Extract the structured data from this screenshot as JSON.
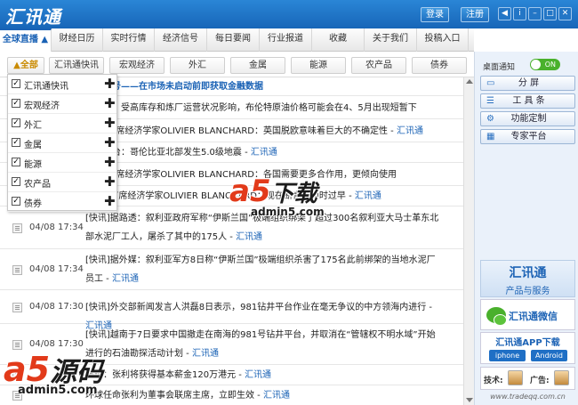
{
  "app": {
    "title": "汇讯通",
    "login_label": "登录",
    "register_label": "注册",
    "window_buttons": [
      "sound-icon",
      "info-icon",
      "minimize-icon",
      "maximize-icon",
      "close-icon"
    ]
  },
  "nav": {
    "items": [
      {
        "label": "全球直播 ▲",
        "active": true
      },
      {
        "label": "财经日历"
      },
      {
        "label": "实时行情"
      },
      {
        "label": "经济信号"
      },
      {
        "label": "每日要闻"
      },
      {
        "label": "行业报道"
      },
      {
        "label": "收藏"
      },
      {
        "label": "关于我们"
      },
      {
        "label": "投稿入口"
      }
    ]
  },
  "subnav": {
    "tabs": [
      {
        "label": "▲全部",
        "active": true
      },
      {
        "label": "汇讯通快讯"
      },
      {
        "label": "宏观经济"
      },
      {
        "label": "外汇"
      },
      {
        "label": "金属"
      },
      {
        "label": "能源"
      },
      {
        "label": "农产品"
      },
      {
        "label": "债券"
      }
    ]
  },
  "filter": {
    "items": [
      {
        "label": "汇讯通快讯",
        "checked": true
      },
      {
        "label": "宏观经济",
        "checked": true
      },
      {
        "label": "外汇",
        "checked": true
      },
      {
        "label": "金属",
        "checked": true
      },
      {
        "label": "能源",
        "checked": true
      },
      {
        "label": "农产品",
        "checked": true
      },
      {
        "label": "债券",
        "checked": true
      }
    ]
  },
  "news": {
    "source_label": "汇讯通",
    "rows": [
      {
        "time": "",
        "lines": [
          "经济信号——在市场未启动前即获取金融数据"
        ],
        "headline": true,
        "source": false
      },
      {
        "time": "",
        "lines": [
          "银美林：受高库存和炼厂运营状况影响，布伦特原油价格可能会在4、5月出现短暂下"
        ],
        "source": false
      },
      {
        "time": "",
        "lines": [
          "MF前首席经济学家OLIVIER BLANCHARD：英国脱欧意味着巨大的不确定性 - "
        ],
        "source": true
      },
      {
        "time": "",
        "lines": [
          "港天文台：哥伦比亚北部发生5.0级地震 - "
        ],
        "source": true
      },
      {
        "time": "",
        "lines": [
          "MF前首席经济学家OLIVIER BLANCHARD：各国需要更多合作用，更倾向使用"
        ],
        "source": false
      },
      {
        "time": "04/08 17:37",
        "lines": [
          "IMF前首席经济学家OLIVIER BLANCHARD：现在断言还为时过早 - "
        ],
        "source": true
      },
      {
        "time": "04/08 17:34",
        "lines": [
          "[快讯]据路透：叙利亚政府军称“伊斯兰国”极端组织绑架了超过300名叙利亚大马士革东北",
          "部水泥厂工人，屠杀了其中的175人 - "
        ],
        "source": true
      },
      {
        "time": "04/08 17:34",
        "lines": [
          "[快讯]据外媒：叙利亚军方8日称“伊斯兰国”极端组织杀害了175名此前绑架的当地水泥厂",
          "员工 - "
        ],
        "source": true
      },
      {
        "time": "04/08 17:30",
        "lines": [
          "[快讯]外交部新闻发言人洪磊8日表示，981钻井平台作业在毫无争议的中方领海内进行 - ",
          ""
        ],
        "source": true
      },
      {
        "time": "04/08 17:30",
        "lines": [
          "[快讯]越南于7日要求中国撤走在南海的981号钻井平台，并取消在“管辖权不明水域”开始",
          "进行的石油勘探活动计划 - "
        ],
        "source": true
      },
      {
        "time": "",
        "lines": [
          "环球：张利将获得基本薪金120万港元 - "
        ],
        "source": true
      },
      {
        "time": "",
        "lines": [
          "环球任命张利为董事会联席主席，立即生效 - "
        ],
        "source": true
      }
    ]
  },
  "sidebar": {
    "notify_label": "桌面通知",
    "toggle_label": "ON",
    "buttons": [
      {
        "label": "分    屏",
        "icon": "split-screen-icon",
        "glyph": "▭"
      },
      {
        "label": "工 具 条",
        "icon": "toolbar-icon",
        "glyph": "☰"
      },
      {
        "label": "功能定制",
        "icon": "settings-icon",
        "glyph": "⚙"
      },
      {
        "label": "专家平台",
        "icon": "grid-icon",
        "glyph": "▦"
      }
    ],
    "ad_product_title": "汇讯通",
    "ad_product_sub": "产品与服务",
    "ad_wechat": "汇讯通微信",
    "ad_app": "汇讯通APP下载",
    "iphone_label": "iphone",
    "android_label": "Android",
    "tech_label": "技术:",
    "ad_label": "广告:",
    "site": "www.tradeqq.com.cn"
  },
  "watermark": {
    "mark_a5": "a5",
    "mark_download": "下载",
    "mark_source": "源码",
    "url": "admin5.com"
  },
  "colors": {
    "brand_blue": "#1a62b5",
    "watermark_red": "#e23a1a",
    "toggle_green": "#4ab12c"
  }
}
